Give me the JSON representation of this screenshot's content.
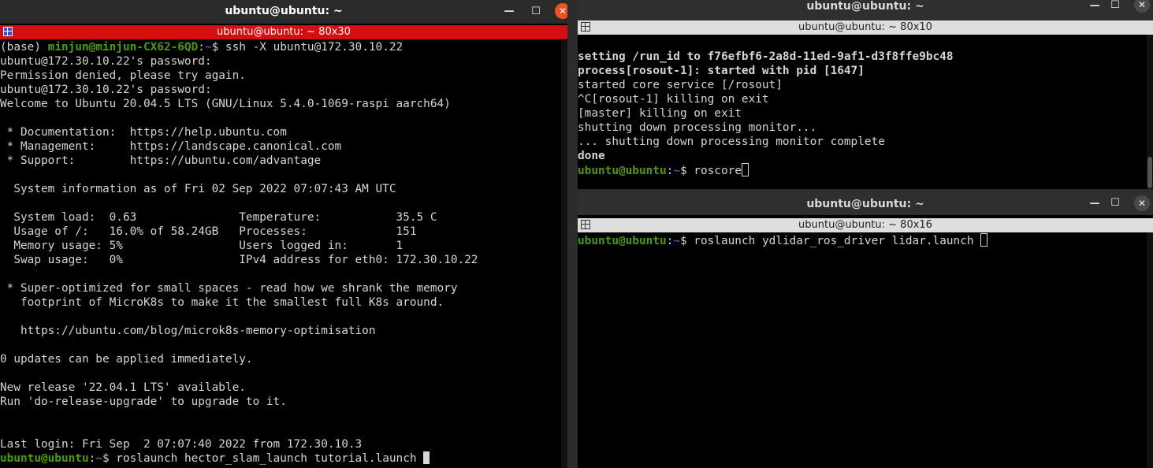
{
  "left": {
    "title": "ubuntu@ubuntu: ~",
    "tab": "ubuntu@ubuntu: ~ 80x30",
    "lines": [
      [
        {
          "t": "(base) "
        },
        {
          "t": "minjun@minjun-CX62-6QD",
          "c": "g"
        },
        {
          "t": ":"
        },
        {
          "t": "~",
          "c": "b"
        },
        {
          "t": "$ ssh -X ubuntu@172.30.10.22"
        }
      ],
      [
        {
          "t": "ubuntu@172.30.10.22's password:"
        }
      ],
      [
        {
          "t": "Permission denied, please try again."
        }
      ],
      [
        {
          "t": "ubuntu@172.30.10.22's password:"
        }
      ],
      [
        {
          "t": "Welcome to Ubuntu 20.04.5 LTS (GNU/Linux 5.4.0-1069-raspi aarch64)"
        }
      ],
      [
        {
          "t": ""
        }
      ],
      [
        {
          "t": " * Documentation:  https://help.ubuntu.com"
        }
      ],
      [
        {
          "t": " * Management:     https://landscape.canonical.com"
        }
      ],
      [
        {
          "t": " * Support:        https://ubuntu.com/advantage"
        }
      ],
      [
        {
          "t": ""
        }
      ],
      [
        {
          "t": "  System information as of Fri 02 Sep 2022 07:07:43 AM UTC"
        }
      ],
      [
        {
          "t": ""
        }
      ],
      [
        {
          "t": "  System load:  0.63               Temperature:           35.5 C"
        }
      ],
      [
        {
          "t": "  Usage of /:   16.0% of 58.24GB   Processes:             151"
        }
      ],
      [
        {
          "t": "  Memory usage: 5%                 Users logged in:       1"
        }
      ],
      [
        {
          "t": "  Swap usage:   0%                 IPv4 address for eth0: 172.30.10.22"
        }
      ],
      [
        {
          "t": ""
        }
      ],
      [
        {
          "t": " * Super-optimized for small spaces - read how we shrank the memory"
        }
      ],
      [
        {
          "t": "   footprint of MicroK8s to make it the smallest full K8s around."
        }
      ],
      [
        {
          "t": ""
        }
      ],
      [
        {
          "t": "   https://ubuntu.com/blog/microk8s-memory-optimisation"
        }
      ],
      [
        {
          "t": ""
        }
      ],
      [
        {
          "t": "0 updates can be applied immediately."
        }
      ],
      [
        {
          "t": ""
        }
      ],
      [
        {
          "t": "New release '22.04.1 LTS' available."
        }
      ],
      [
        {
          "t": "Run 'do-release-upgrade' to upgrade to it."
        }
      ],
      [
        {
          "t": ""
        }
      ],
      [
        {
          "t": ""
        }
      ],
      [
        {
          "t": "Last login: Fri Sep  2 07:07:40 2022 from 172.30.10.3"
        }
      ],
      [
        {
          "t": "ubuntu@ubuntu",
          "c": "g"
        },
        {
          "t": ":"
        },
        {
          "t": "~",
          "c": "b"
        },
        {
          "t": "$ roslaunch hector_slam_launch tutorial.launch "
        },
        {
          "cur": "solid"
        }
      ]
    ]
  },
  "top_right": {
    "title": "ubuntu@ubuntu: ~",
    "tab": "ubuntu@ubuntu: ~ 80x10",
    "lines": [
      [
        {
          "t": "setting /run_id to f76efbf6-2a8d-11ed-9af1-d3f8ffe9bc48",
          "c": "bo"
        }
      ],
      [
        {
          "t": "process[rosout-1]: started with pid [1647]",
          "c": "bo"
        }
      ],
      [
        {
          "t": "started core service [/rosout]"
        }
      ],
      [
        {
          "t": "^C[rosout-1] killing on exit"
        }
      ],
      [
        {
          "t": "[master] killing on exit"
        }
      ],
      [
        {
          "t": "shutting down processing monitor..."
        }
      ],
      [
        {
          "t": "... shutting down processing monitor complete"
        }
      ],
      [
        {
          "t": "done",
          "c": "bo"
        }
      ],
      [
        {
          "t": "ubuntu@ubuntu",
          "c": "g"
        },
        {
          "t": ":"
        },
        {
          "t": "~",
          "c": "b"
        },
        {
          "t": "$ roscore"
        },
        {
          "cur": "hollow"
        }
      ]
    ]
  },
  "bottom_right": {
    "title": "ubuntu@ubuntu: ~",
    "tab": "ubuntu@ubuntu: ~ 80x16",
    "lines": [
      [
        {
          "t": "ubuntu@ubuntu",
          "c": "g"
        },
        {
          "t": ":"
        },
        {
          "t": "~",
          "c": "b"
        },
        {
          "t": "$ roslaunch ydlidar_ros_driver lidar.launch "
        },
        {
          "cur": "hollow"
        }
      ]
    ]
  },
  "controls": {
    "minimize": "—",
    "maximize": "☐",
    "close": "✕"
  },
  "colors": {
    "prompt_user": "#4e9a06",
    "prompt_path": "#3465a4",
    "active_tab": "#d50f0f",
    "close_active": "#e95420"
  }
}
